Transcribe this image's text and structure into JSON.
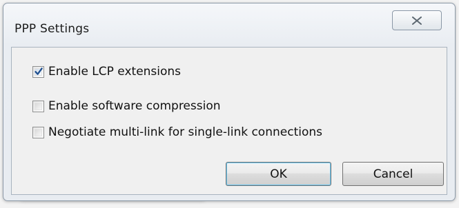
{
  "dialog": {
    "title": "PPP Settings",
    "close_icon": "close-icon"
  },
  "options": [
    {
      "label": "Enable LCP extensions",
      "checked": true
    },
    {
      "label": "Enable software compression",
      "checked": false
    },
    {
      "label": "Negotiate multi-link for single-link connections",
      "checked": false
    }
  ],
  "buttons": {
    "ok_label": "OK",
    "cancel_label": "Cancel"
  },
  "colors": {
    "accent_focus": "#65c6f2",
    "check_mark": "#1f4f8f",
    "window_border": "#8d9aa8"
  }
}
